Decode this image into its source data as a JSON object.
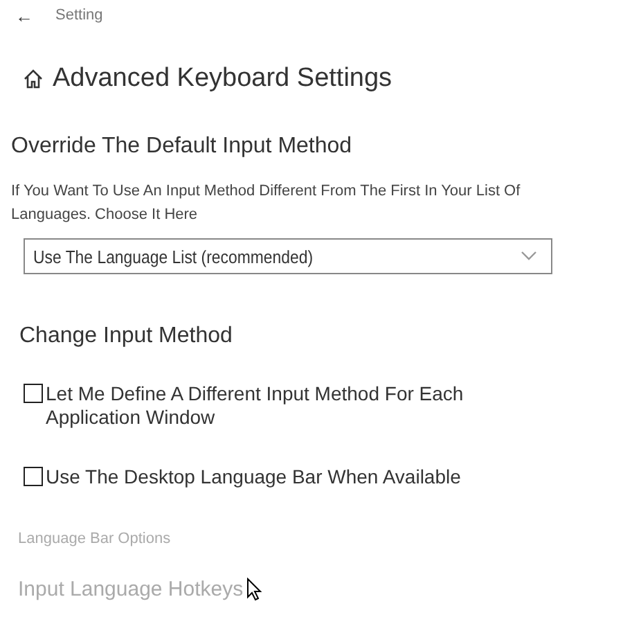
{
  "header": {
    "back": "←",
    "title": "Setting"
  },
  "page_title": "Advanced Keyboard Settings",
  "override": {
    "heading": "Override The Default Input Method",
    "description": "If You Want To Use An Input Method Different From The First In Your List Of Languages. Choose It Here",
    "dropdown": {
      "value": "Use The Language List (recommended)"
    }
  },
  "change": {
    "heading": "Change Input Method",
    "checkboxes": [
      {
        "label": "Let Me Define A Different Input Method For Each Application Window",
        "checked": false
      },
      {
        "label": "Use The Desktop Language Bar When Available",
        "checked": false
      }
    ]
  },
  "links": [
    {
      "label": "Language Bar Options",
      "kind": "small"
    },
    {
      "label": "Input Language Hotkeys",
      "kind": "large"
    }
  ]
}
